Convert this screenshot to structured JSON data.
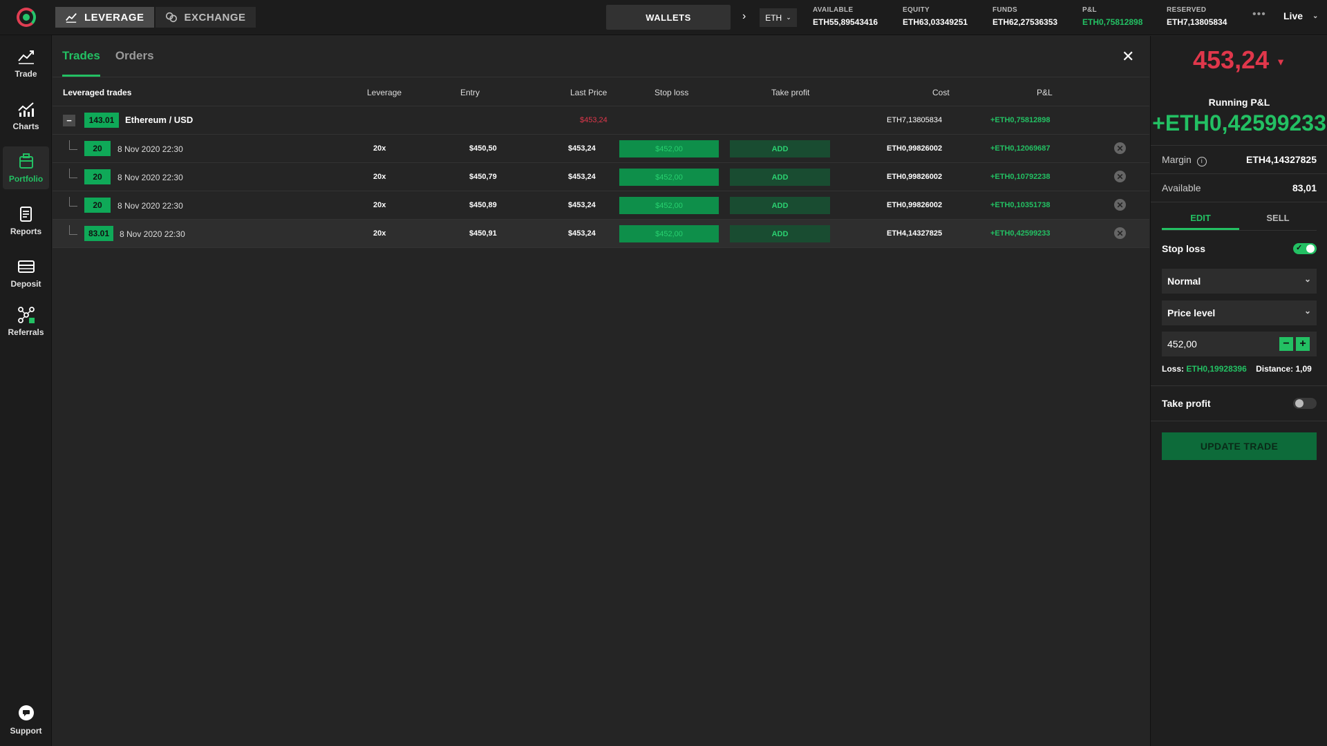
{
  "topbar": {
    "mode_tabs": [
      "LEVERAGE",
      "EXCHANGE"
    ],
    "wallets_label": "WALLETS",
    "currency": "ETH",
    "stats": [
      {
        "label": "AVAILABLE",
        "value": "ETH55,89543416"
      },
      {
        "label": "EQUITY",
        "value": "ETH63,03349251"
      },
      {
        "label": "FUNDS",
        "value": "ETH62,27536353"
      },
      {
        "label": "P&L",
        "value": "ETH0,75812898"
      },
      {
        "label": "RESERVED",
        "value": "ETH7,13805834"
      }
    ],
    "more": "•••",
    "live_label": "Live"
  },
  "sidebar": {
    "items": [
      {
        "label": "Trade",
        "icon": "trade-chart-icon"
      },
      {
        "label": "Charts",
        "icon": "charts-icon"
      },
      {
        "label": "Portfolio",
        "icon": "portfolio-icon"
      },
      {
        "label": "Reports",
        "icon": "reports-icon"
      },
      {
        "label": "Deposit",
        "icon": "deposit-icon"
      },
      {
        "label": "Referrals",
        "icon": "referrals-icon"
      }
    ],
    "support_label": "Support"
  },
  "main": {
    "tabs": [
      "Trades",
      "Orders"
    ],
    "columns": [
      "Leveraged trades",
      "Leverage",
      "Entry",
      "Last Price",
      "Stop loss",
      "Take profit",
      "Cost",
      "P&L"
    ],
    "group": {
      "amount": "143.01",
      "instrument": "Ethereum / USD",
      "last_price": "$453,24",
      "cost": "ETH7,13805834",
      "pnl": "+ETH0,75812898"
    },
    "trades": [
      {
        "amount": "20",
        "date": "8 Nov 2020 22:30",
        "leverage": "20x",
        "entry": "$450,50",
        "last": "$453,24",
        "stop_loss": "$452,00",
        "take_profit": "ADD",
        "cost": "ETH0,99826002",
        "pnl": "+ETH0,12069687"
      },
      {
        "amount": "20",
        "date": "8 Nov 2020 22:30",
        "leverage": "20x",
        "entry": "$450,79",
        "last": "$453,24",
        "stop_loss": "$452,00",
        "take_profit": "ADD",
        "cost": "ETH0,99826002",
        "pnl": "+ETH0,10792238"
      },
      {
        "amount": "20",
        "date": "8 Nov 2020 22:30",
        "leverage": "20x",
        "entry": "$450,89",
        "last": "$453,24",
        "stop_loss": "$452,00",
        "take_profit": "ADD",
        "cost": "ETH0,99826002",
        "pnl": "+ETH0,10351738"
      },
      {
        "amount": "83.01",
        "date": "8 Nov 2020 22:30",
        "leverage": "20x",
        "entry": "$450,91",
        "last": "$453,24",
        "stop_loss": "$452,00",
        "take_profit": "ADD",
        "cost": "ETH4,14327825",
        "pnl": "+ETH0,42599233"
      }
    ]
  },
  "panel": {
    "price": "453,24",
    "running_label": "Running P&L",
    "running_value": "+ETH0,42599233",
    "margin_label": "Margin",
    "margin_value": "ETH4,14327825",
    "available_label": "Available",
    "available_value": "83,01",
    "tabs": [
      "EDIT",
      "SELL"
    ],
    "stop_loss_label": "Stop loss",
    "stop_loss_enabled": true,
    "stop_type": "Normal",
    "level_type": "Price level",
    "level_value": "452,00",
    "loss_label": "Loss:",
    "loss_value": "ETH0,19928396",
    "distance_label": "Distance:",
    "distance_value": "1,09",
    "take_profit_label": "Take profit",
    "take_profit_enabled": false,
    "update_label": "UPDATE TRADE"
  },
  "colors": {
    "accent_green": "#23c063",
    "red": "#e0374b"
  }
}
